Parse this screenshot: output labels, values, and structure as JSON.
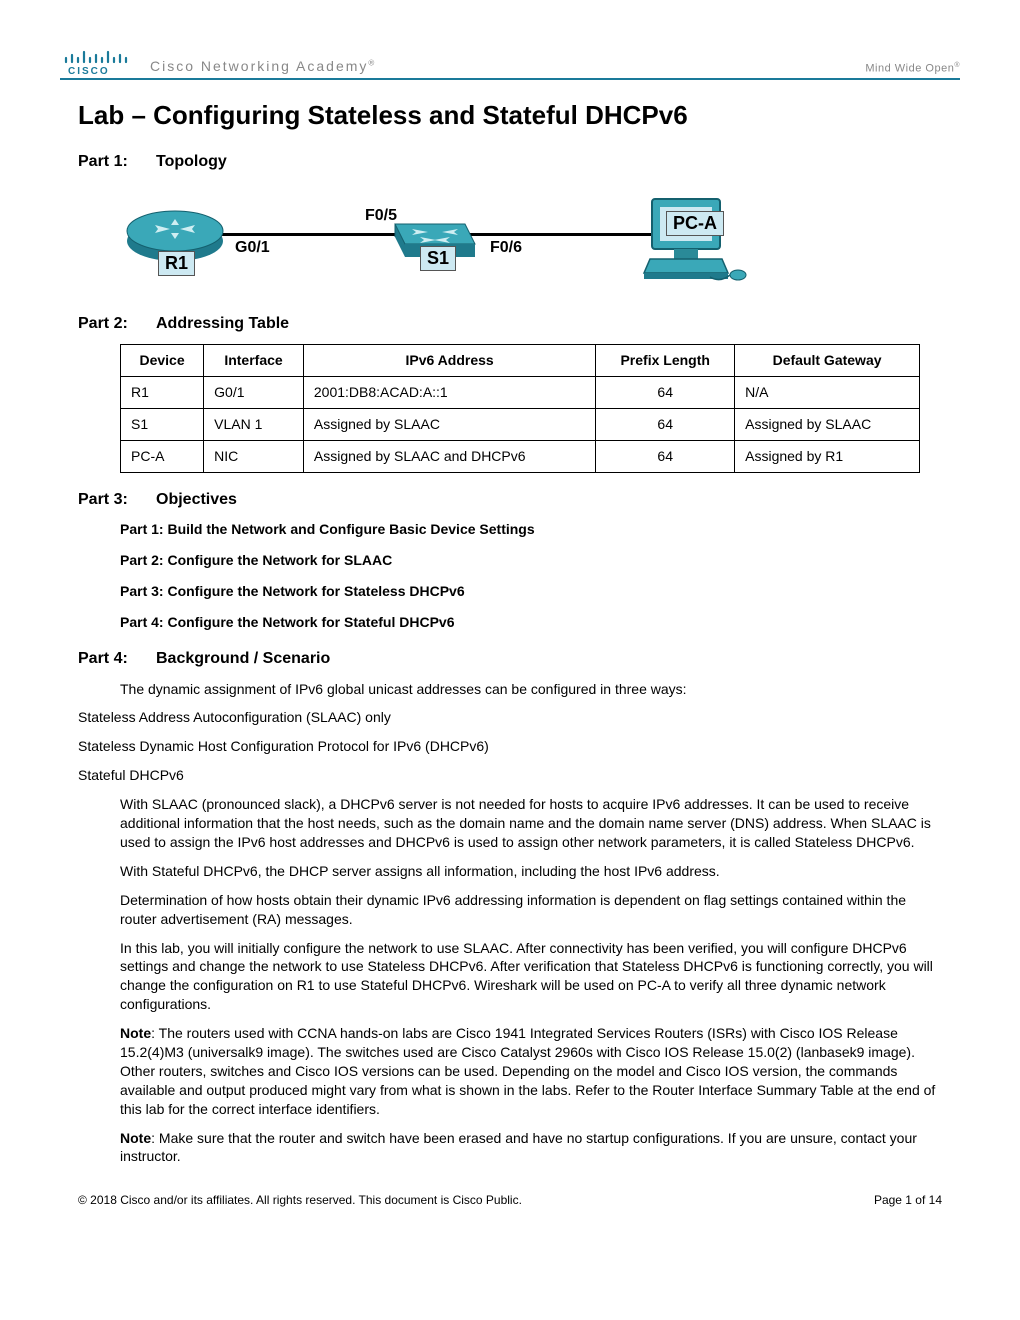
{
  "header": {
    "brand": "CISCO",
    "academy": "Cisco Networking Academy",
    "tagline": "Mind Wide Open"
  },
  "title": "Lab – Configuring Stateless and Stateful DHCPv6",
  "parts": {
    "p1": {
      "label": "Part 1:",
      "title": "Topology"
    },
    "p2": {
      "label": "Part 2:",
      "title": "Addressing Table"
    },
    "p3": {
      "label": "Part 3:",
      "title": "Objectives"
    },
    "p4": {
      "label": "Part 4:",
      "title": "Background / Scenario"
    }
  },
  "topology": {
    "r1": "R1",
    "s1": "S1",
    "pca": "PC-A",
    "g01": "G0/1",
    "f05": "F0/5",
    "f06": "F0/6"
  },
  "table": {
    "headers": [
      "Device",
      "Interface",
      "IPv6 Address",
      "Prefix Length",
      "Default Gateway"
    ],
    "rows": [
      [
        "R1",
        "G0/1",
        "2001:DB8:ACAD:A::1",
        "64",
        "N/A"
      ],
      [
        "S1",
        "VLAN 1",
        "Assigned by SLAAC",
        "64",
        "Assigned by SLAAC"
      ],
      [
        "PC-A",
        "NIC",
        "Assigned by SLAAC and DHCPv6",
        "64",
        "Assigned by R1"
      ]
    ]
  },
  "objectives": [
    "Part 1: Build the Network and Configure Basic Device Settings",
    "Part 2: Configure the Network for SLAAC",
    "Part 3: Configure the Network for Stateless DHCPv6",
    "Part 4: Configure the Network for Stateful DHCPv6"
  ],
  "background": {
    "intro": "The dynamic assignment of IPv6 global unicast addresses can be configured in three ways:",
    "modes": [
      "Stateless Address Autoconfiguration (SLAAC) only",
      "Stateless Dynamic Host Configuration Protocol for IPv6 (DHCPv6)",
      "Stateful DHCPv6"
    ],
    "p_slaac": "With SLAAC (pronounced slack), a DHCPv6 server is not needed for hosts to acquire IPv6 addresses. It can be used to receive additional information that the host needs, such as the domain name and the domain name server (DNS) address. When SLAAC is used to assign the IPv6 host addresses and DHCPv6 is used to assign other network parameters, it is called Stateless DHCPv6.",
    "p_stateful": "With Stateful DHCPv6, the DHCP server assigns all information, including the host IPv6 address.",
    "p_determination": "Determination of how hosts obtain their dynamic IPv6 addressing information is dependent on flag settings contained within the router advertisement (RA) messages.",
    "p_lab": "In this lab, you will initially configure the network to use SLAAC. After connectivity has been verified, you will configure DHCPv6 settings and change the network to use Stateless DHCPv6. After verification that Stateless DHCPv6 is functioning correctly, you will change the configuration on R1 to use Stateful DHCPv6. Wireshark will be used on PC-A to verify all three dynamic network configurations.",
    "note1_label": "Note",
    "note1_text": ": The routers used with CCNA hands-on labs are Cisco 1941 Integrated Services Routers (ISRs) with Cisco IOS Release 15.2(4)M3 (universalk9 image). The switches used are Cisco Catalyst 2960s with Cisco IOS Release 15.0(2) (lanbasek9 image). Other routers, switches and Cisco IOS versions can be used. Depending on the model and Cisco IOS version, the commands available and output produced might vary from what is shown in the labs. Refer to the Router Interface Summary Table at the end of this lab for the correct interface identifiers.",
    "note2_label": "Note",
    "note2_text": ": Make sure that the router and switch have been erased and have no startup configurations. If you are unsure, contact your instructor."
  },
  "footer": {
    "copyright": "© 2018 Cisco and/or its affiliates. All rights reserved. This document is Cisco Public.",
    "page": "Page 1 of 14"
  }
}
